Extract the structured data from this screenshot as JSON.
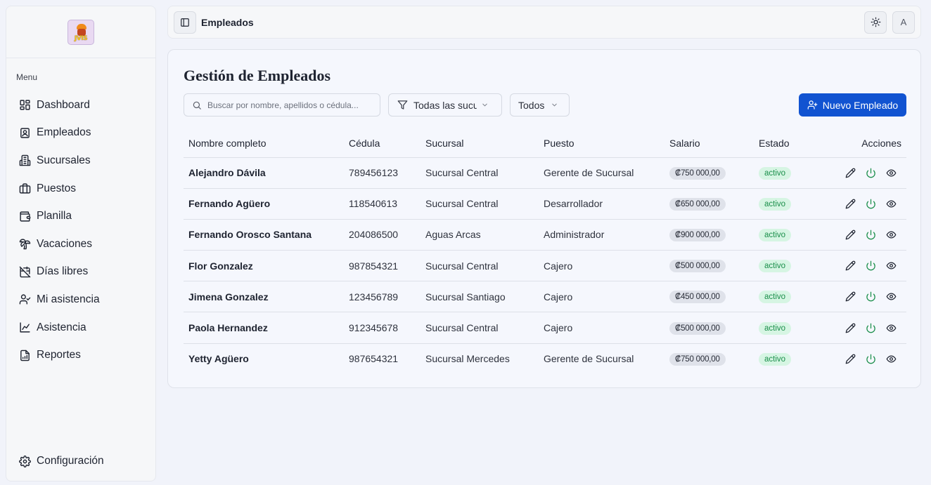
{
  "brand": {
    "logo_text": "JVIS"
  },
  "sidebar": {
    "menu_label": "Menu",
    "items": [
      {
        "label": "Dashboard",
        "icon": "dashboard-icon"
      },
      {
        "label": "Empleados",
        "icon": "contact-book-icon"
      },
      {
        "label": "Sucursales",
        "icon": "building-icon"
      },
      {
        "label": "Puestos",
        "icon": "briefcase-icon"
      },
      {
        "label": "Planilla",
        "icon": "wallet-icon"
      },
      {
        "label": "Vacaciones",
        "icon": "palm-tree-icon"
      },
      {
        "label": "Días libres",
        "icon": "calendar-off-icon"
      },
      {
        "label": "Mi asistencia",
        "icon": "user-check-icon"
      },
      {
        "label": "Asistencia",
        "icon": "area-chart-icon"
      },
      {
        "label": "Reportes",
        "icon": "report-file-icon"
      }
    ],
    "config_label": "Configuración"
  },
  "header": {
    "title": "Empleados",
    "avatar_initial": "A"
  },
  "main": {
    "title": "Gestión de Empleados",
    "search_placeholder": "Buscar por nombre, apellidos o cédula...",
    "branch_filter": "Todas las sucursales",
    "status_filter": "Todos",
    "new_button": "Nuevo Empleado",
    "columns": [
      "Nombre completo",
      "Cédula",
      "Sucursal",
      "Puesto",
      "Salario",
      "Estado",
      "Acciones"
    ],
    "rows": [
      {
        "name": "Alejandro Dávila",
        "id": "789456123",
        "branch": "Sucursal Central",
        "position": "Gerente de Sucursal",
        "salary": "₡750 000,00",
        "status": "activo"
      },
      {
        "name": "Fernando Agüero",
        "id": "118540613",
        "branch": "Sucursal Central",
        "position": "Desarrollador",
        "salary": "₡650 000,00",
        "status": "activo"
      },
      {
        "name": "Fernando Orosco Santana",
        "id": "204086500",
        "branch": "Aguas Arcas",
        "position": "Administrador",
        "salary": "₡900 000,00",
        "status": "activo"
      },
      {
        "name": "Flor Gonzalez",
        "id": "987854321",
        "branch": "Sucursal Central",
        "position": "Cajero",
        "salary": "₡500 000,00",
        "status": "activo"
      },
      {
        "name": "Jimena Gonzalez",
        "id": "123456789",
        "branch": "Sucursal Santiago",
        "position": "Cajero",
        "salary": "₡450 000,00",
        "status": "activo"
      },
      {
        "name": "Paola Hernandez",
        "id": "912345678",
        "branch": "Sucursal Central",
        "position": "Cajero",
        "salary": "₡500 000,00",
        "status": "activo"
      },
      {
        "name": "Yetty Agüero",
        "id": "987654321",
        "branch": "Sucursal Mercedes",
        "position": "Gerente de Sucursal",
        "salary": "₡750 000,00",
        "status": "activo"
      }
    ]
  },
  "colors": {
    "primary": "#1153d1",
    "status_active_bg": "#d6f5e3",
    "status_active_text": "#1a8e4a",
    "power_icon": "#1a8e4a"
  }
}
